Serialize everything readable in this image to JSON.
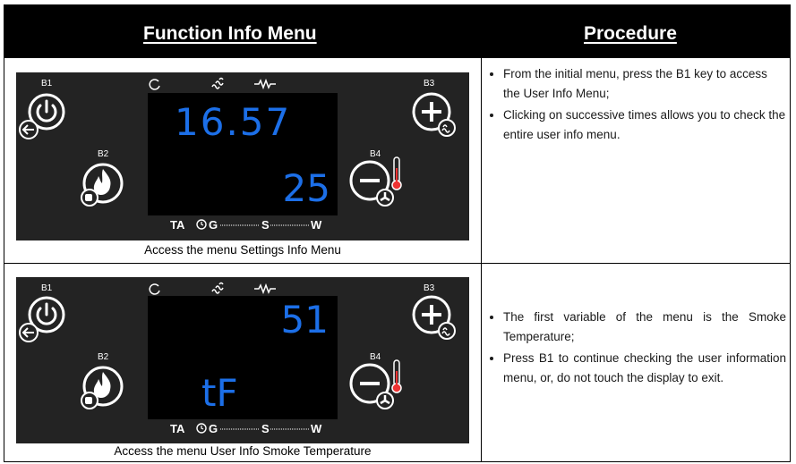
{
  "header": {
    "left_title": "Function Info Menu",
    "right_title": "Procedure"
  },
  "rows": [
    {
      "display": {
        "b1": "B1",
        "b2": "B2",
        "b3": "B3",
        "b4": "B4",
        "top_value": "16.57",
        "bottom_value": "25",
        "ta": "TA",
        "g": "G",
        "s": "S",
        "w": "W"
      },
      "caption": "Access the menu Settings Info Menu",
      "procedure": [
        "From the initial menu, press the B1 key to access the User Info Menu;",
        "Clicking on successive times allows you to check the entire user info menu."
      ]
    },
    {
      "display": {
        "b1": "B1",
        "b2": "B2",
        "b3": "B3",
        "b4": "B4",
        "top_value": "51",
        "bottom_value": "tF",
        "ta": "TA",
        "g": "G",
        "s": "S",
        "w": "W"
      },
      "caption": "Access the menu User Info Smoke Temperature",
      "procedure": [
        "The first variable of the menu is the Smoke Temperature;",
        "Press B1 to continue checking the user information menu, or, do not touch the display to exit."
      ]
    }
  ],
  "colors": {
    "panel": "#232323",
    "screen": "#000000",
    "digits": "#1c6fe8",
    "header": "#000000"
  },
  "icons": [
    "power-icon",
    "flame-icon",
    "plus-icon",
    "minus-icon",
    "thermometer-icon",
    "fan-icon",
    "hand-icon",
    "arrow-left-icon",
    "refresh-icon",
    "resistor-icon",
    "hot-air-icon",
    "clock-icon"
  ]
}
